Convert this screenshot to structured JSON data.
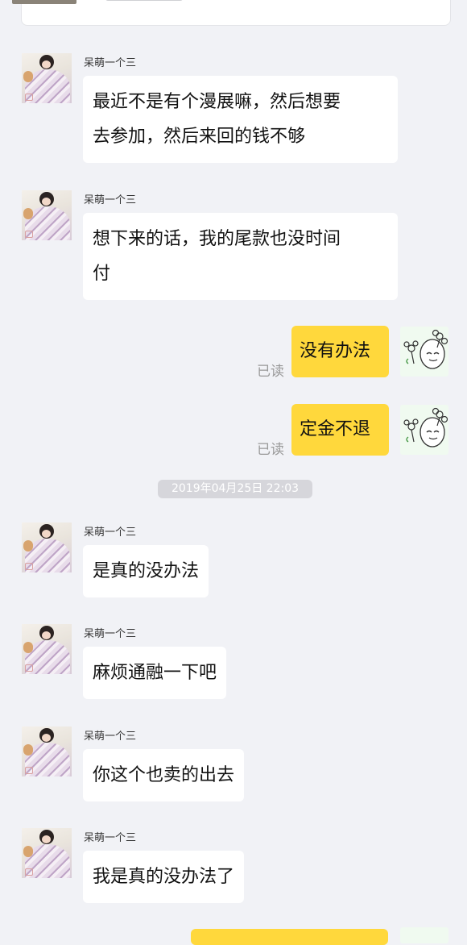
{
  "chat": {
    "read_label": "已读",
    "timestamp": "2019年04月25日 22:03",
    "contact_name": "呆萌一个三",
    "messages": [
      {
        "text_lines": [
          "最近不是有个漫展嘛，然后想要",
          "去参加，然后来回的钱不够"
        ]
      },
      {
        "text_lines": [
          "想下来的话，我的尾款也没时间",
          "付"
        ]
      },
      {
        "text": "没有办法"
      },
      {
        "text": "定金不退"
      },
      {
        "text": "是真的没办法"
      },
      {
        "text": "麻烦通融一下吧"
      },
      {
        "text": "你这个也卖的出去"
      },
      {
        "text": "我是真的没办法了"
      }
    ]
  }
}
